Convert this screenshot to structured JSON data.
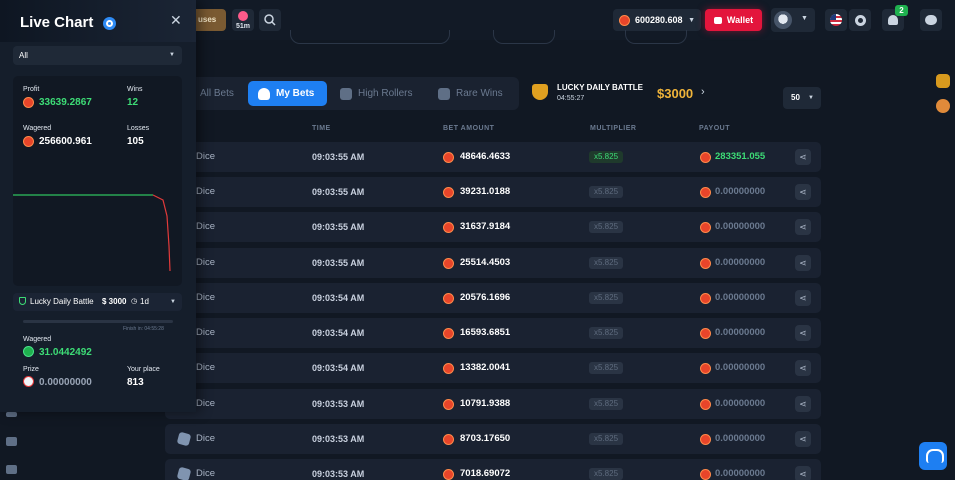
{
  "topbar": {
    "bonus_label": "uses",
    "timer_label": "51m",
    "balance": "600280.608",
    "wallet_label": "Wallet",
    "notification_count": "2"
  },
  "tabs": [
    {
      "label": "All Bets",
      "active": false
    },
    {
      "label": "My Bets",
      "active": true
    },
    {
      "label": "High Rollers",
      "active": false
    },
    {
      "label": "Rare Wins",
      "active": false
    }
  ],
  "battle": {
    "title": "LUCKY DAILY BATTLE",
    "timer": "04:55:27",
    "prize": "$3000"
  },
  "page_size": "50",
  "table": {
    "headers": [
      "TIME",
      "BET AMOUNT",
      "MULTIPLIER",
      "PAYOUT"
    ],
    "rows": [
      {
        "game": "Dice",
        "time": "09:03:55 AM",
        "amount": "48646.4633",
        "multiplier": "x5.825",
        "payout": "283351.055",
        "win": true
      },
      {
        "game": "Dice",
        "time": "09:03:55 AM",
        "amount": "39231.0188",
        "multiplier": "x5.825",
        "payout": "0.00000000",
        "win": false
      },
      {
        "game": "Dice",
        "time": "09:03:55 AM",
        "amount": "31637.9184",
        "multiplier": "x5.825",
        "payout": "0.00000000",
        "win": false
      },
      {
        "game": "Dice",
        "time": "09:03:55 AM",
        "amount": "25514.4503",
        "multiplier": "x5.825",
        "payout": "0.00000000",
        "win": false
      },
      {
        "game": "Dice",
        "time": "09:03:54 AM",
        "amount": "20576.1696",
        "multiplier": "x5.825",
        "payout": "0.00000000",
        "win": false
      },
      {
        "game": "Dice",
        "time": "09:03:54 AM",
        "amount": "16593.6851",
        "multiplier": "x5.825",
        "payout": "0.00000000",
        "win": false
      },
      {
        "game": "Dice",
        "time": "09:03:54 AM",
        "amount": "13382.0041",
        "multiplier": "x5.825",
        "payout": "0.00000000",
        "win": false
      },
      {
        "game": "Dice",
        "time": "09:03:53 AM",
        "amount": "10791.9388",
        "multiplier": "x5.825",
        "payout": "0.00000000",
        "win": false
      },
      {
        "game": "Dice",
        "time": "09:03:53 AM",
        "amount": "8703.17650",
        "multiplier": "x5.825",
        "payout": "0.00000000",
        "win": false
      },
      {
        "game": "Dice",
        "time": "09:03:53 AM",
        "amount": "7018.69072",
        "multiplier": "x5.825",
        "payout": "0.00000000",
        "win": false
      }
    ]
  },
  "live_chart": {
    "title": "Live Chart",
    "filter": "All",
    "profit_label": "Profit",
    "profit": "33639.2867",
    "wins_label": "Wins",
    "wins": "12",
    "wagered_label": "Wagered",
    "wagered": "256600.961",
    "losses_label": "Losses",
    "losses": "105",
    "battle_name": "Lucky Daily Battle",
    "battle_prize": "$ 3000",
    "battle_period": "1d",
    "finish_text": "Finish in: 04:55:28",
    "battle_wagered_label": "Wagered",
    "battle_wagered": "31.0442492",
    "prize_label": "Prize",
    "prize": "0.00000000",
    "place_label": "Your place",
    "place": "813"
  }
}
